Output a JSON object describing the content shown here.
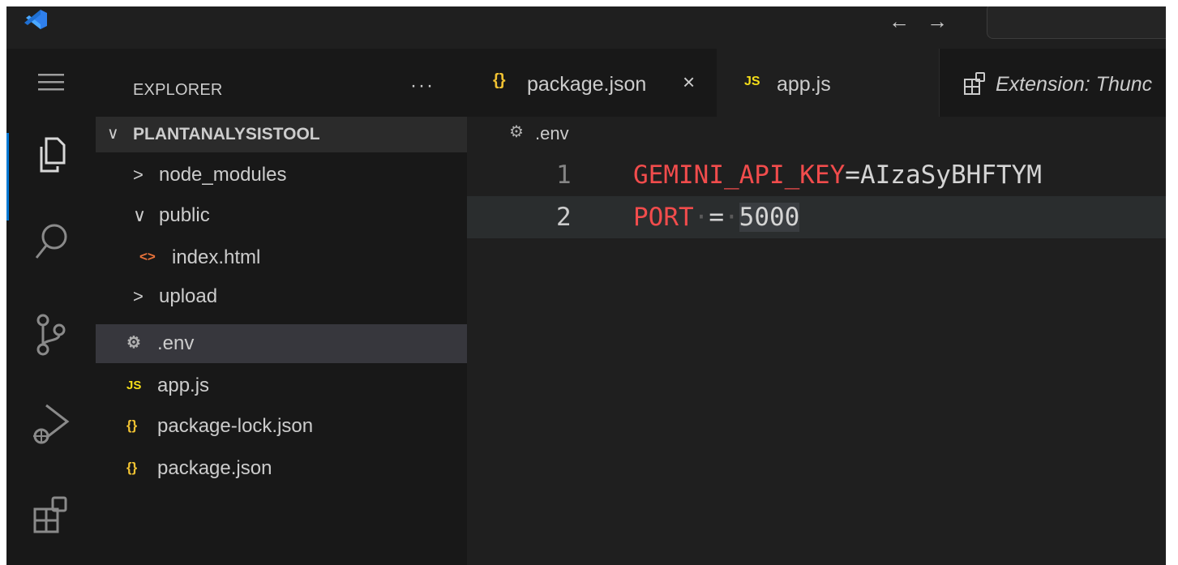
{
  "colors": {
    "accent": "#0078d4",
    "json_icon": "#f1c232",
    "js_icon": "#f5de19",
    "html_icon": "#e8723a",
    "env_key": "#f14c4c"
  },
  "titlebar": {
    "back_icon": "←",
    "forward_icon": "→"
  },
  "activitybar": {
    "items": [
      "explorer-icon",
      "search-icon",
      "source-control-icon",
      "run-debug-icon",
      "extensions-icon"
    ]
  },
  "sidebar": {
    "title": "EXPLORER",
    "more": "···",
    "folder": "PLANTANALYSISTOOL",
    "items": [
      {
        "label": "node_modules",
        "icon": "chevron-right",
        "glyph": ">"
      },
      {
        "label": "public",
        "icon": "chevron-down",
        "glyph": "∨"
      },
      {
        "label": "index.html",
        "icon": "html-file-icon",
        "glyph": "<>"
      },
      {
        "label": "upload",
        "icon": "chevron-right",
        "glyph": ">"
      },
      {
        "label": ".env",
        "icon": "gear-icon",
        "glyph": "⚙"
      },
      {
        "label": "app.js",
        "icon": "js-file-icon",
        "glyph": "JS"
      },
      {
        "label": "package-lock.json",
        "icon": "json-file-icon",
        "glyph": "{}"
      },
      {
        "label": "package.json",
        "icon": "json-file-icon",
        "glyph": "{}"
      }
    ]
  },
  "tabs": [
    {
      "label": "package.json",
      "glyph": "{}",
      "close": "×"
    },
    {
      "label": "app.js",
      "glyph": "JS"
    },
    {
      "label": "Extension: Thunc",
      "glyph": ""
    }
  ],
  "breadcrumb": {
    "glyph": "⚙",
    "label": ".env"
  },
  "code": {
    "lines": [
      {
        "num": "1",
        "key": "GEMINI_API_KEY",
        "op": "=",
        "value": "AIzaSyBHFTYM"
      },
      {
        "num": "2",
        "key": "PORT",
        "op": "=",
        "value": "5000"
      }
    ]
  }
}
